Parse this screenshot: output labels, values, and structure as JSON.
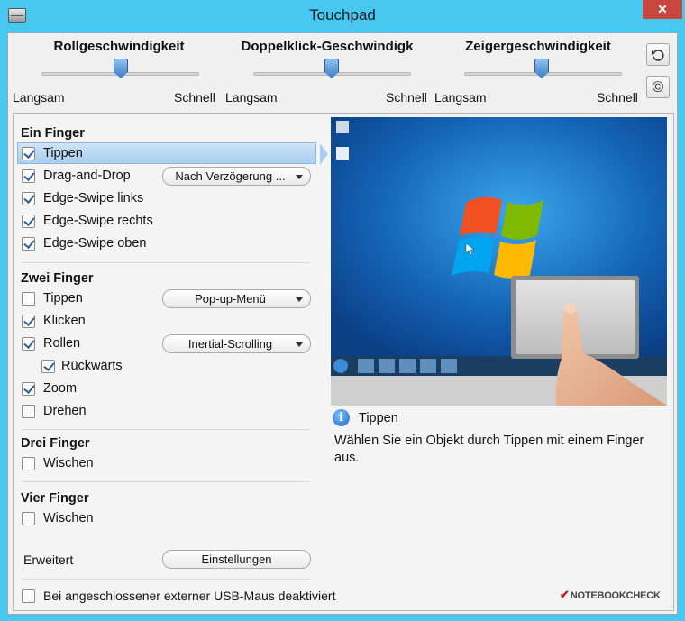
{
  "window": {
    "title": "Touchpad",
    "close_label": "✕",
    "reset_icon": "undo-arrow-icon",
    "copyright_icon": "copyright-icon"
  },
  "sliders": [
    {
      "title": "Rollgeschwindigkeit",
      "slow": "Langsam",
      "fast": "Schnell",
      "value": 0.5
    },
    {
      "title": "Doppelklick-Geschwindigk",
      "slow": "Langsam",
      "fast": "Schnell",
      "value": 0.5
    },
    {
      "title": "Zeigergeschwindigkeit",
      "slow": "Langsam",
      "fast": "Schnell",
      "value": 0.5
    }
  ],
  "one_finger": {
    "heading": "Ein Finger",
    "items": [
      {
        "label": "Tippen",
        "checked": true
      },
      {
        "label": "Drag-and-Drop",
        "checked": true
      },
      {
        "label": "Edge-Swipe links",
        "checked": true
      },
      {
        "label": "Edge-Swipe rechts",
        "checked": true
      },
      {
        "label": "Edge-Swipe oben",
        "checked": true
      }
    ],
    "drag_dropdown": "Nach Verzögerung ..."
  },
  "two_finger": {
    "heading": "Zwei Finger",
    "items": [
      {
        "label": "Tippen",
        "checked": false
      },
      {
        "label": "Klicken",
        "checked": true
      },
      {
        "label": "Rollen",
        "checked": true
      },
      {
        "label": "Rückwärts",
        "checked": true
      },
      {
        "label": "Zoom",
        "checked": true
      },
      {
        "label": "Drehen",
        "checked": false
      }
    ],
    "tap_dropdown": "Pop-up-Menü",
    "scroll_dropdown": "Inertial-Scrolling"
  },
  "three_finger": {
    "heading": "Drei Finger",
    "items": [
      {
        "label": "Wischen",
        "checked": false
      }
    ]
  },
  "four_finger": {
    "heading": "Vier Finger",
    "items": [
      {
        "label": "Wischen",
        "checked": false
      }
    ]
  },
  "advanced": {
    "label": "Erweitert",
    "button": "Einstellungen"
  },
  "usb_mouse": {
    "label": "Bei angeschlossener externer USB-Maus deaktiviert",
    "checked": false
  },
  "info": {
    "title": "Tippen",
    "description": "Wählen Sie ein Objekt durch Tippen mit einem Finger aus."
  },
  "watermark": "NOTEBOOKCHECK",
  "colors": {
    "window_frame": "#47c8f1",
    "close_button": "#c7463e",
    "selection": "#a9cff0"
  }
}
